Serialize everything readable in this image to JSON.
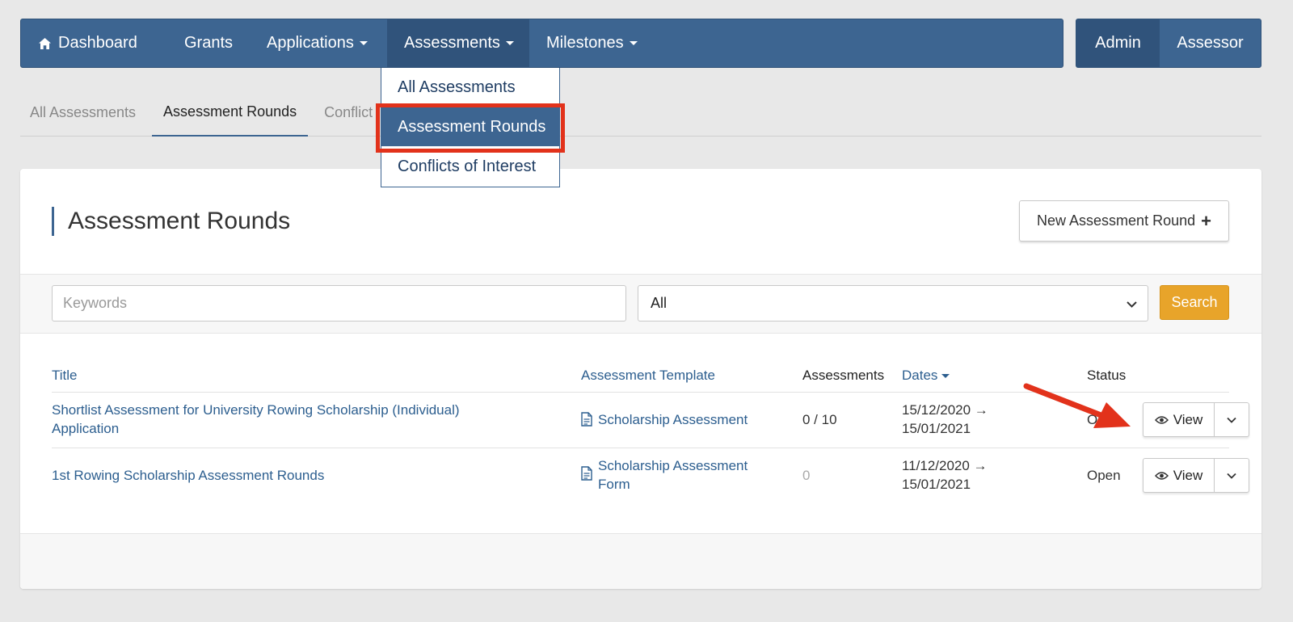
{
  "nav": {
    "items": [
      {
        "label": "Dashboard",
        "icon": "home-icon"
      },
      {
        "label": "Grants"
      },
      {
        "label": "Applications"
      },
      {
        "label": "Assessments"
      },
      {
        "label": "Milestones"
      }
    ],
    "roles": [
      "Admin",
      "Assessor"
    ]
  },
  "dropdown": {
    "items": [
      "All Assessments",
      "Assessment Rounds",
      "Conflicts of Interest"
    ],
    "selected": "Assessment Rounds"
  },
  "subtabs": [
    "All Assessments",
    "Assessment Rounds",
    "Conflict"
  ],
  "page": {
    "title": "Assessment Rounds",
    "new_button": "New Assessment Round"
  },
  "filters": {
    "keywords_placeholder": "Keywords",
    "status_value": "All",
    "search_label": "Search"
  },
  "table": {
    "headers": {
      "title": "Title",
      "template": "Assessment Template",
      "assessments": "Assessments",
      "dates": "Dates",
      "status": "Status"
    },
    "rows": [
      {
        "title_line1": "Shortlist Assessment for University Rowing Scholarship (Individual)",
        "title_line2": "Application",
        "template_line1": "Scholarship Assessment",
        "template_line2": "",
        "assessments": "0 / 10",
        "date_line1": "15/12/2020 →",
        "date_line2": "15/01/2021",
        "status": "Open",
        "view": "View"
      },
      {
        "title_line1": "1st Rowing Scholarship Assessment Rounds",
        "title_line2": "",
        "template_line1": "Scholarship Assessment",
        "template_line2": "Form",
        "assessments": "0",
        "date_line1": "11/12/2020 →",
        "date_line2": "15/01/2021",
        "status": "Open",
        "view": "View"
      }
    ]
  },
  "colors": {
    "navbar": "#3d6591",
    "accent_link": "#2c5e8f",
    "search_button": "#e8a42a",
    "annotation": "#e2321b"
  }
}
